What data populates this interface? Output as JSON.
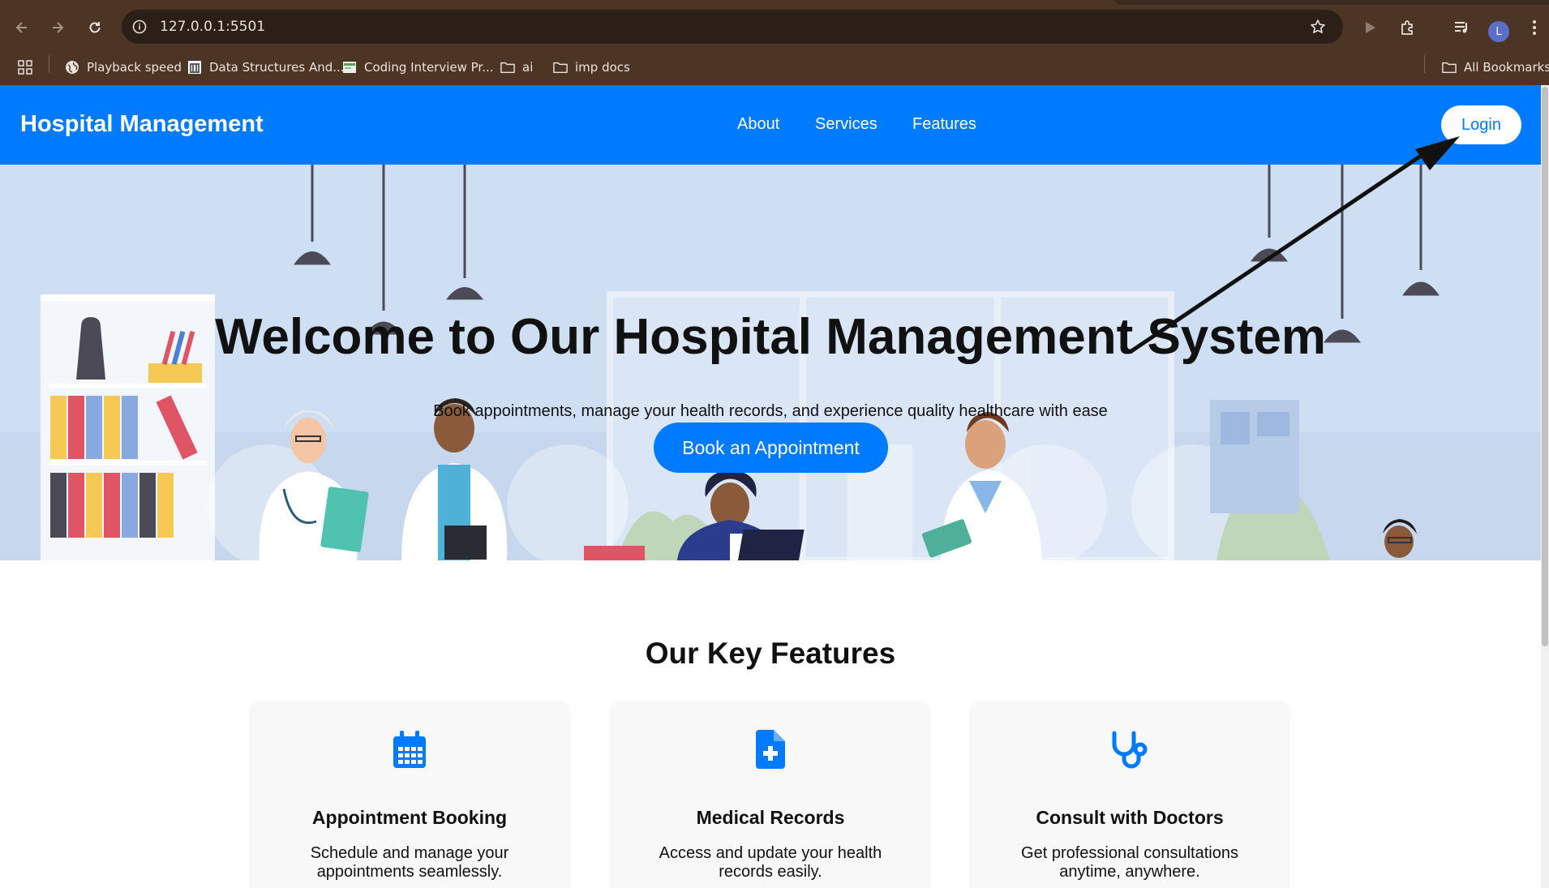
{
  "browser": {
    "url": "127.0.0.1:5501",
    "profile_initial": "L",
    "bookmarks": [
      {
        "label": "Playback speed",
        "icon": "globe-icon"
      },
      {
        "label": "Data Structures And...",
        "icon": "library-icon"
      },
      {
        "label": "Coding Interview Pr...",
        "icon": "site-favicon-icon"
      },
      {
        "label": "ai",
        "icon": "folder-icon"
      },
      {
        "label": "imp docs",
        "icon": "folder-icon"
      }
    ],
    "all_bookmarks": "All Bookmarks"
  },
  "header": {
    "brand": "Hospital Management",
    "nav": [
      "About",
      "Services",
      "Features"
    ],
    "login": "Login"
  },
  "hero": {
    "title": "Welcome to Our Hospital Management System",
    "subtitle": "Book appointments, manage your health records, and experience quality healthcare with ease",
    "cta": "Book an Appointment"
  },
  "features": {
    "title": "Our Key Features",
    "cards": [
      {
        "icon": "calendar-icon",
        "title": "Appointment Booking",
        "desc": "Schedule and manage your appointments seamlessly."
      },
      {
        "icon": "medical-file-icon",
        "title": "Medical Records",
        "desc": "Access and update your health records easily."
      },
      {
        "icon": "stethoscope-icon",
        "title": "Consult with Doctors",
        "desc": "Get professional consultations anytime, anywhere."
      }
    ]
  },
  "colors": {
    "primary": "#007bff",
    "hero_bg": "#cfdff3",
    "chrome": "#4d3526",
    "annotation_arrow": "#111111"
  }
}
